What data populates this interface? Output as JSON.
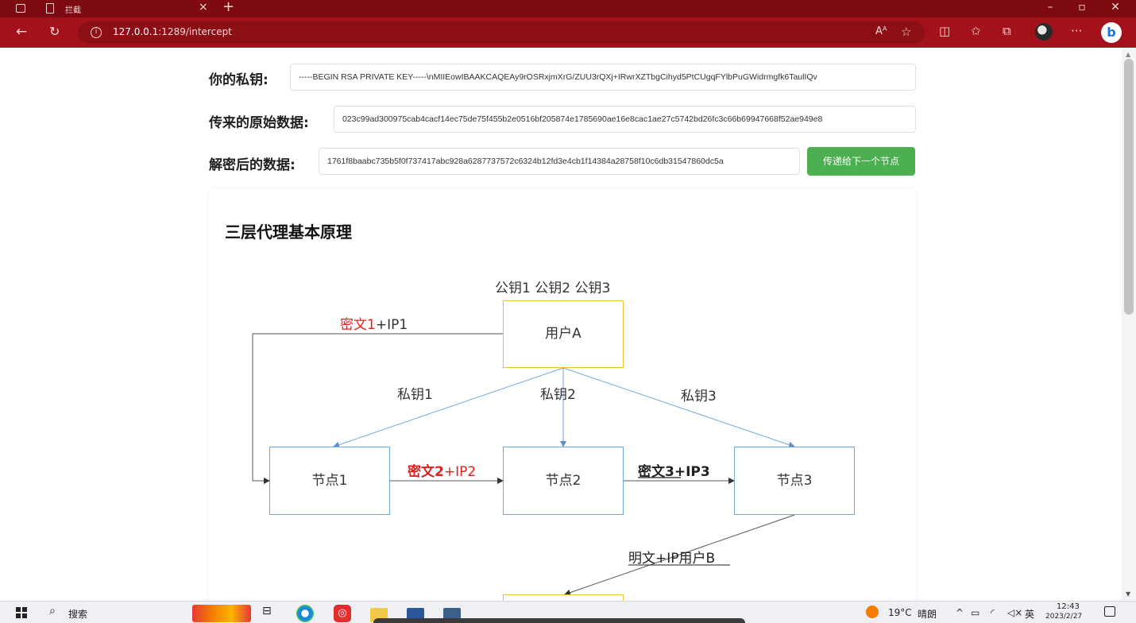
{
  "browser": {
    "tab_title": "拦截",
    "url_host": "127.0.0.1",
    "url_rest": ":1289/intercept",
    "read_aloud": "Aᴬ",
    "colors": {
      "titlebar": "#7d0a10",
      "addressbar": "#a3121a"
    }
  },
  "form": {
    "private_key_label": "你的私钥:",
    "private_key_value": "-----BEGIN RSA PRIVATE KEY-----\\nMIIEowIBAAKCAQEAy9rOSRxjmXrG/ZUU3rQXj+IRwrXZTbgCihyd5PtCUgqFYlbPuGWidrmgfk6TaulIQv",
    "raw_data_label": "传来的原始数据:",
    "raw_data_value": "023c99ad300975cab4cacf14ec75de75f455b2e0516bf205874e1785690ae16e8cac1ae27c5742bd26fc3c66b69947668f52ae949e8",
    "decrypted_label": "解密后的数据:",
    "decrypted_value": "1761f8baabc735b5f0f737417abc928a6287737572c6324b12fd3e4cb1f14384a28758f10c6db31547860dc5a",
    "pass_button": "传递给下一个节点",
    "pass_button_color": "#4caf50"
  },
  "diagram": {
    "title": "三层代理基本原理",
    "public_keys": "公钥1 公钥2 公钥3",
    "user_a": "用户A",
    "cipher1": "密文1",
    "ip1": "+IP1",
    "private_key1": "私钥1",
    "private_key2": "私钥2",
    "private_key3": "私钥3",
    "node1": "节点1",
    "node2": "节点2",
    "node3": "节点3",
    "cipher2": "密文2",
    "ip2": "+IP2",
    "cipher3": "密文3",
    "ip3": "+IP3",
    "plaintext": "明文+IP用户B",
    "colors": {
      "red": "#e0201e",
      "user_border": "#f0c030",
      "node_border": "#6fa8dc"
    }
  },
  "taskbar": {
    "search_label": "搜索",
    "weather_temp": "19°C",
    "weather_text": "晴朗",
    "ime": "英",
    "clock_time": "12:43",
    "clock_date": "2023/2/27"
  }
}
